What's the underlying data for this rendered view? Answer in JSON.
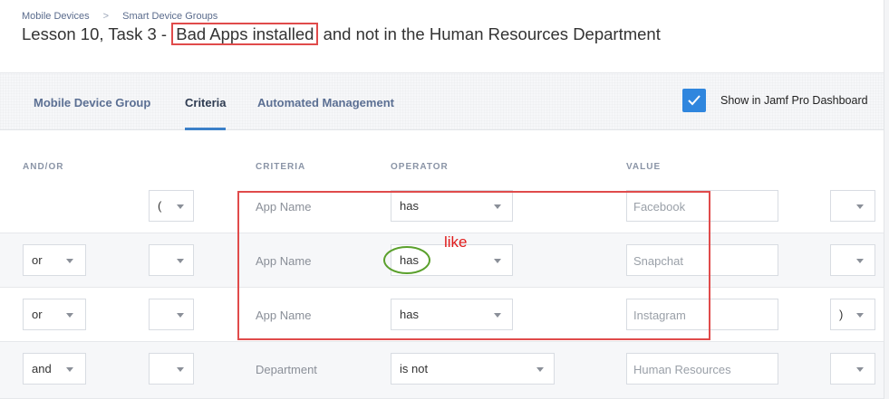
{
  "breadcrumb": {
    "item1": "Mobile Devices",
    "separator": ">",
    "item2": "Smart Device Groups"
  },
  "title": {
    "prefix": "Lesson 10, Task 3 - ",
    "highlight": "Bad Apps installed",
    "suffix": " and not in the Human Resources Department"
  },
  "tabs": [
    {
      "label": "Mobile Device Group",
      "active": false
    },
    {
      "label": "Criteria",
      "active": true
    },
    {
      "label": "Automated Management",
      "active": false
    }
  ],
  "dashboard": {
    "label": "Show in Jamf Pro Dashboard",
    "checked": true
  },
  "columns": {
    "andor": "AND/OR",
    "criteria": "CRITERIA",
    "operator": "OPERATOR",
    "value": "VALUE"
  },
  "rows": [
    {
      "andor": "",
      "open_paren": "(",
      "criteria": "App Name",
      "operator": "has",
      "value": "Facebook",
      "close_paren": ""
    },
    {
      "andor": "or",
      "open_paren": "",
      "criteria": "App Name",
      "operator": "has",
      "value": "Snapchat",
      "close_paren": ""
    },
    {
      "andor": "or",
      "open_paren": "",
      "criteria": "App Name",
      "operator": "has",
      "value": "Instagram",
      "close_paren": ")"
    },
    {
      "andor": "and",
      "open_paren": "",
      "criteria": "Department",
      "operator": "is not",
      "value": "Human Resources",
      "close_paren": ""
    }
  ],
  "annotation": {
    "note": "like"
  },
  "colors": {
    "accent": "#2f86de",
    "highlight_box": "#e04b4b",
    "highlight_oval": "#5aa02c",
    "note_text": "#e01b1b"
  }
}
